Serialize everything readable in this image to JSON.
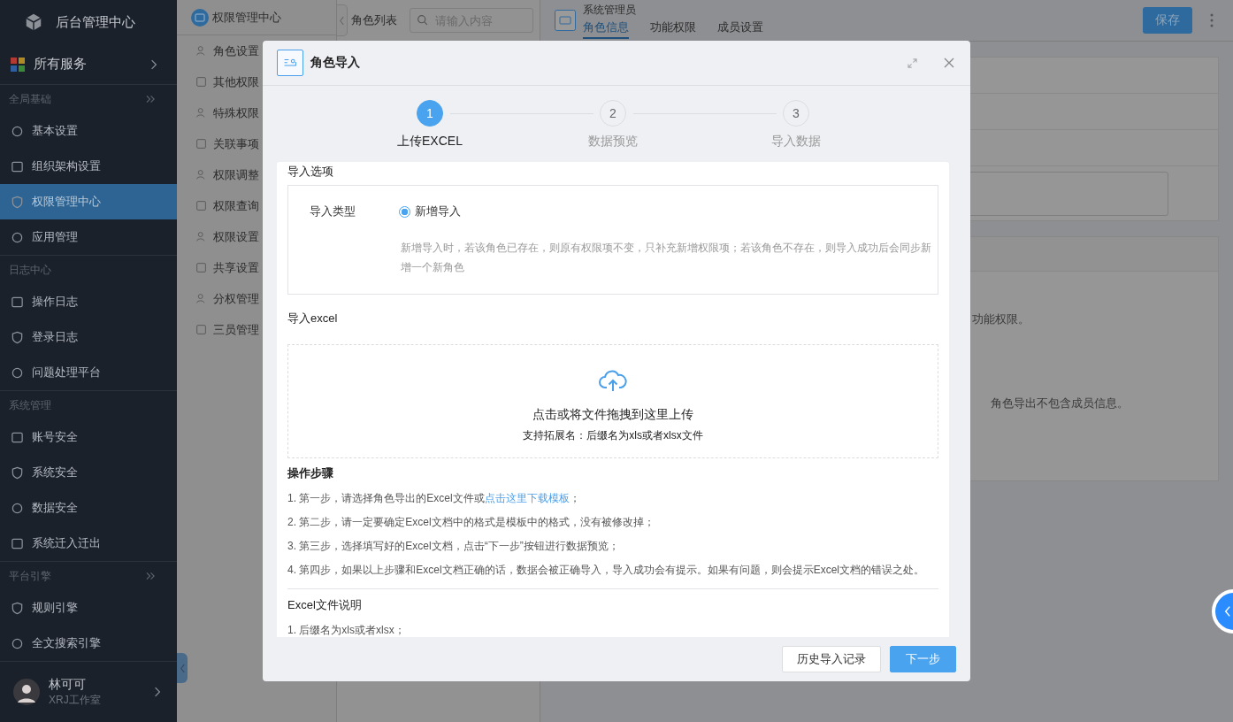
{
  "sidebar": {
    "title": "后台管理中心",
    "all_services": "所有服务",
    "groups": [
      {
        "title": "全局基础",
        "collapsible": true,
        "items": [
          {
            "label": "基本设置",
            "selected": false
          },
          {
            "label": "组织架构设置",
            "selected": false
          },
          {
            "label": "权限管理中心",
            "selected": true
          },
          {
            "label": "应用管理",
            "selected": false
          }
        ]
      },
      {
        "title": "日志中心",
        "collapsible": false,
        "items": [
          {
            "label": "操作日志",
            "selected": false
          },
          {
            "label": "登录日志",
            "selected": false
          },
          {
            "label": "问题处理平台",
            "selected": false
          }
        ]
      },
      {
        "title": "系统管理",
        "collapsible": false,
        "items": [
          {
            "label": "账号安全",
            "selected": false
          },
          {
            "label": "系统安全",
            "selected": false
          },
          {
            "label": "数据安全",
            "selected": false
          },
          {
            "label": "系统迁入迁出",
            "selected": false
          }
        ]
      },
      {
        "title": "平台引擎",
        "collapsible": true,
        "items": [
          {
            "label": "规则引擎",
            "selected": false
          },
          {
            "label": "全文搜索引擎",
            "selected": false
          }
        ]
      }
    ],
    "user": {
      "name": "林可可",
      "org": "XRJ工作室"
    }
  },
  "submenu": {
    "title": "权限管理中心",
    "items": [
      "角色设置",
      "其他权限",
      "特殊权限",
      "关联事项",
      "权限调整",
      "权限查询",
      "权限设置",
      "共享设置",
      "分权管理",
      "三员管理"
    ]
  },
  "role_list": {
    "title": "角色列表",
    "search": {
      "placeholder": "请输入内容"
    }
  },
  "main": {
    "title": "系统管理员",
    "tabs": [
      {
        "label": "角色信息",
        "selected": true
      },
      {
        "label": "功能权限",
        "selected": false
      },
      {
        "label": "成员设置",
        "selected": false
      }
    ],
    "save": "保存",
    "notes": [
      "功能权限。",
      "角色导出不包含成员信息。"
    ]
  },
  "dialog": {
    "title": "角色导入",
    "steps": [
      {
        "number": "1",
        "label": "上传EXCEL",
        "selected": true
      },
      {
        "number": "2",
        "label": "数据预览",
        "selected": false
      },
      {
        "number": "3",
        "label": "导入数据",
        "selected": false
      }
    ],
    "options": {
      "title": "导入选项",
      "field_label": "导入类型",
      "radio": {
        "label": "新增导入",
        "checked": true
      },
      "description": "新增导入时，若该角色已存在，则原有权限项不变，只补充新增权限项；若该角色不存在，则导入成功后会同步新增一个新角色"
    },
    "upload": {
      "title": "导入excel",
      "prompt": "点击或将文件拖拽到这里上传",
      "hint": "支持拓展名：后缀名为xls或者xlsx文件"
    },
    "steps_title": "操作步骤",
    "instructions": [
      {
        "text": "1. 第一步，请选择角色导出的Excel文件或",
        "link": "点击这里下载模板",
        "after": "；"
      },
      {
        "text": "2. 第二步，请一定要确定Excel文档中的格式是模板中的格式，没有被修改掉；"
      },
      {
        "text": "3. 第三步，选择填写好的Excel文档，点击“下一步”按钮进行数据预览；"
      },
      {
        "text": "4. 第四步，如果以上步骤和Excel文档正确的话，数据会被正确导入，导入成功会有提示。如果有问题，则会提示Excel文档的错误之处。"
      }
    ],
    "file_notes": {
      "title": "Excel文件说明",
      "items": [
        "1. 后缀名为xls或者xlsx；"
      ]
    },
    "buttons": {
      "history": "历史导入记录",
      "next": "下一步"
    }
  }
}
